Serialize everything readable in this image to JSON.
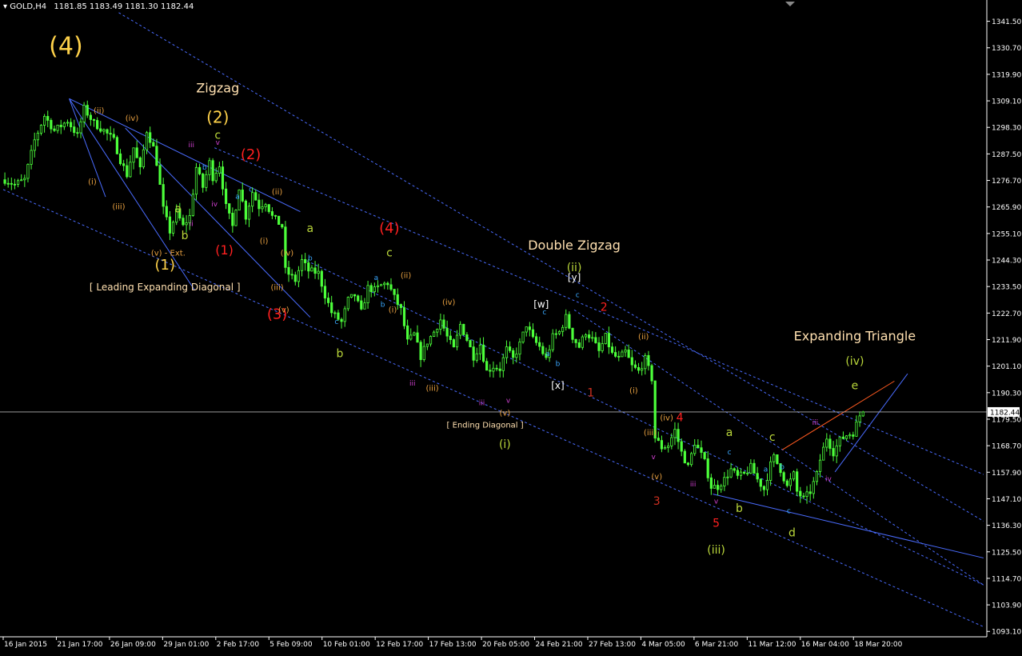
{
  "header": {
    "symbol": "GOLD,H4",
    "ohlc": "1181.85 1183.49 1181.30 1182.44",
    "menu_icon": "triangle-down-icon"
  },
  "colors": {
    "background": "#000000",
    "candle": "#4cff3a",
    "axis": "#ffffff",
    "channel": "#4a6cff",
    "wave_big": "#ffd24a",
    "wave_red": "#ff2020",
    "wave_olive": "#b9d63a",
    "wave_orange": "#e8a040",
    "wave_cyan": "#3aa8ff",
    "wave_magenta": "#d040d0",
    "wave_darkred": "#d03020",
    "label_beige": "#ffe0b0"
  },
  "chart_data": {
    "type": "candlestick",
    "title": "GOLD,H4",
    "ylim": [
      1093.1,
      1348
    ],
    "price_ticks": [
      "1341.50",
      "1330.70",
      "1319.90",
      "1309.10",
      "1298.30",
      "1287.50",
      "1276.70",
      "1265.90",
      "1255.10",
      "1244.30",
      "1233.50",
      "1222.70",
      "1211.90",
      "1201.10",
      "1190.30",
      "1179.50",
      "1168.70",
      "1157.90",
      "1147.10",
      "1136.30",
      "1125.50",
      "1114.70",
      "1103.90",
      "1093.10"
    ],
    "current_price": "1182.44",
    "time_ticks": [
      "16 Jan 2015",
      "21 Jan 17:00",
      "26 Jan 09:00",
      "29 Jan 01:00",
      "2 Feb 17:00",
      "5 Feb 09:00",
      "10 Feb 01:00",
      "12 Feb 17:00",
      "17 Feb 13:00",
      "20 Feb 05:00",
      "24 Feb 21:00",
      "27 Feb 13:00",
      "4 Mar 05:00",
      "6 Mar 21:00",
      "11 Mar 12:00",
      "16 Mar 04:00",
      "18 Mar 20:00"
    ],
    "close_path": [
      [
        0,
        1277
      ],
      [
        3,
        1275
      ],
      [
        6,
        1277
      ],
      [
        9,
        1293
      ],
      [
        12,
        1303
      ],
      [
        15,
        1297
      ],
      [
        19,
        1301
      ],
      [
        22,
        1295
      ],
      [
        24,
        1306
      ],
      [
        27,
        1300
      ],
      [
        30,
        1297
      ],
      [
        33,
        1293
      ],
      [
        35,
        1285
      ],
      [
        37,
        1279
      ],
      [
        39,
        1290
      ],
      [
        41,
        1281
      ],
      [
        43,
        1297
      ],
      [
        45,
        1290
      ],
      [
        46,
        1284
      ],
      [
        48,
        1265
      ],
      [
        50,
        1256
      ],
      [
        52,
        1264
      ],
      [
        54,
        1258
      ],
      [
        56,
        1262
      ],
      [
        58,
        1282
      ],
      [
        60,
        1274
      ],
      [
        62,
        1284
      ],
      [
        63,
        1278
      ],
      [
        65,
        1283
      ],
      [
        67,
        1266
      ],
      [
        69,
        1258
      ],
      [
        71,
        1274
      ],
      [
        73,
        1262
      ],
      [
        75,
        1272
      ],
      [
        77,
        1266
      ],
      [
        79,
        1268
      ],
      [
        81,
        1262
      ],
      [
        84,
        1258
      ],
      [
        85,
        1240
      ],
      [
        88,
        1236
      ],
      [
        90,
        1244
      ],
      [
        92,
        1240
      ],
      [
        95,
        1239
      ],
      [
        97,
        1230
      ],
      [
        99,
        1223
      ],
      [
        102,
        1219
      ],
      [
        104,
        1228
      ],
      [
        106,
        1230
      ],
      [
        108,
        1223
      ],
      [
        110,
        1233
      ],
      [
        112,
        1232
      ],
      [
        114,
        1234
      ],
      [
        116,
        1235
      ],
      [
        118,
        1229
      ],
      [
        120,
        1224
      ],
      [
        122,
        1211
      ],
      [
        124,
        1214
      ],
      [
        126,
        1205
      ],
      [
        128,
        1211
      ],
      [
        130,
        1215
      ],
      [
        132,
        1220
      ],
      [
        134,
        1213
      ],
      [
        136,
        1208
      ],
      [
        138,
        1218
      ],
      [
        140,
        1212
      ],
      [
        142,
        1205
      ],
      [
        144,
        1210
      ],
      [
        146,
        1199
      ],
      [
        148,
        1201
      ],
      [
        150,
        1200
      ],
      [
        152,
        1208
      ],
      [
        154,
        1204
      ],
      [
        156,
        1210
      ],
      [
        158,
        1218
      ],
      [
        160,
        1212
      ],
      [
        162,
        1209
      ],
      [
        164,
        1204
      ],
      [
        166,
        1213
      ],
      [
        168,
        1215
      ],
      [
        170,
        1221
      ],
      [
        172,
        1213
      ],
      [
        174,
        1209
      ],
      [
        176,
        1215
      ],
      [
        178,
        1212
      ],
      [
        180,
        1207
      ],
      [
        182,
        1213
      ],
      [
        184,
        1206
      ],
      [
        186,
        1204
      ],
      [
        188,
        1207
      ],
      [
        190,
        1201
      ],
      [
        192,
        1199
      ],
      [
        194,
        1204
      ],
      [
        196,
        1196
      ],
      [
        197,
        1172
      ],
      [
        199,
        1168
      ],
      [
        201,
        1169
      ],
      [
        203,
        1175
      ],
      [
        205,
        1166
      ],
      [
        207,
        1160
      ],
      [
        209,
        1170
      ],
      [
        211,
        1165
      ],
      [
        212,
        1162
      ],
      [
        214,
        1152
      ],
      [
        216,
        1152
      ],
      [
        218,
        1155
      ],
      [
        220,
        1159
      ],
      [
        222,
        1156
      ],
      [
        224,
        1157
      ],
      [
        226,
        1160
      ],
      [
        228,
        1155
      ],
      [
        230,
        1151
      ],
      [
        232,
        1161
      ],
      [
        233,
        1164
      ],
      [
        235,
        1159
      ],
      [
        237,
        1152
      ],
      [
        239,
        1157
      ],
      [
        240,
        1150
      ],
      [
        242,
        1147
      ],
      [
        244,
        1150
      ],
      [
        246,
        1157
      ],
      [
        247,
        1163
      ],
      [
        249,
        1172
      ],
      [
        251,
        1166
      ],
      [
        253,
        1171
      ],
      [
        255,
        1173
      ],
      [
        257,
        1174
      ],
      [
        259,
        1181
      ],
      [
        260,
        1182.44
      ]
    ],
    "last_bar_index": 260,
    "channels": [
      {
        "from": [
          20,
          1310
        ],
        "to": [
          90,
          1264
        ],
        "style": "solid"
      },
      {
        "from": [
          20,
          1310
        ],
        "to": [
          58,
          1232
        ],
        "style": "solid"
      },
      {
        "from": [
          20,
          1310
        ],
        "to": [
          31,
          1270
        ],
        "style": "solid"
      },
      {
        "from": [
          37,
          1298
        ],
        "to": [
          93,
          1221
        ],
        "style": "solid"
      },
      {
        "from": [
          0,
          1273
        ],
        "to": [
          297,
          1095
        ],
        "style": "dashed"
      },
      {
        "from": [
          35,
          1345
        ],
        "to": [
          297,
          1138
        ],
        "style": "dashed"
      },
      {
        "from": [
          92,
          1244
        ],
        "to": [
          297,
          1112
        ],
        "style": "dashed"
      },
      {
        "from": [
          64,
          1290
        ],
        "to": [
          297,
          1157
        ],
        "style": "dashed"
      },
      {
        "from": [
          173,
          1224
        ],
        "to": [
          297,
          1112
        ],
        "style": "dashed"
      },
      {
        "from": [
          215,
          1149
        ],
        "to": [
          297,
          1123
        ],
        "style": "solid"
      },
      {
        "from": [
          252,
          1158
        ],
        "to": [
          274,
          1198
        ],
        "style": "solid"
      },
      {
        "from": [
          236,
          1167
        ],
        "to": [
          270,
          1195
        ],
        "style": "solid-orange"
      }
    ]
  },
  "annotations": [
    {
      "text": "(4)",
      "x": 19,
      "y": 1331,
      "color": "wave_big",
      "size": 30
    },
    {
      "text": "Zigzag",
      "x": 65,
      "y": 1314,
      "color": "label_beige",
      "size": 16
    },
    {
      "text": "(2)",
      "x": 65,
      "y": 1302,
      "color": "wave_big",
      "size": 20
    },
    {
      "text": "c",
      "x": 65,
      "y": 1295,
      "color": "wave_olive",
      "size": 14
    },
    {
      "text": "(2)",
      "x": 75,
      "y": 1287,
      "color": "wave_red",
      "size": 18
    },
    {
      "text": "(1)",
      "x": 49,
      "y": 1242,
      "color": "wave_big",
      "size": 18
    },
    {
      "text": "(1)",
      "x": 67,
      "y": 1248,
      "color": "wave_red",
      "size": 16
    },
    {
      "text": "(3)",
      "x": 83,
      "y": 1222,
      "color": "wave_red",
      "size": 18
    },
    {
      "text": "(4)",
      "x": 117,
      "y": 1257,
      "color": "wave_red",
      "size": 18
    },
    {
      "text": "c",
      "x": 117,
      "y": 1247,
      "color": "wave_olive",
      "size": 14
    },
    {
      "text": "a",
      "x": 93,
      "y": 1257,
      "color": "wave_olive",
      "size": 14
    },
    {
      "text": "b",
      "x": 102,
      "y": 1206,
      "color": "wave_olive",
      "size": 14
    },
    {
      "text": "a",
      "x": 53,
      "y": 1265,
      "color": "wave_olive",
      "size": 14
    },
    {
      "text": "b",
      "x": 55,
      "y": 1254,
      "color": "wave_olive",
      "size": 14
    },
    {
      "text": "(v) - Ext.",
      "x": 50,
      "y": 1247,
      "color": "wave_orange",
      "size": 10
    },
    {
      "text": "[ Leading Expanding Diagonal ]",
      "x": 49,
      "y": 1233,
      "color": "label_beige",
      "size": 12
    },
    {
      "text": "Double Zigzag",
      "x": 173,
      "y": 1250,
      "color": "label_beige",
      "size": 16
    },
    {
      "text": "(ii)",
      "x": 173,
      "y": 1241,
      "color": "wave_olive",
      "size": 14
    },
    {
      "text": "[y]",
      "x": 173,
      "y": 1237,
      "color": "#ffffff",
      "size": 12
    },
    {
      "text": "[w]",
      "x": 163,
      "y": 1226,
      "color": "#ffffff",
      "size": 12
    },
    {
      "text": "[x]",
      "x": 168,
      "y": 1193,
      "color": "#ffffff",
      "size": 12
    },
    {
      "text": "[ Ending Diagonal ]",
      "x": 146,
      "y": 1177,
      "color": "label_beige",
      "size": 10
    },
    {
      "text": "(i)",
      "x": 152,
      "y": 1169,
      "color": "wave_olive",
      "size": 14
    },
    {
      "text": "(v)",
      "x": 152,
      "y": 1182,
      "color": "wave_orange",
      "size": 10
    },
    {
      "text": "2",
      "x": 182,
      "y": 1225,
      "color": "wave_red",
      "size": 14
    },
    {
      "text": "1",
      "x": 178,
      "y": 1190,
      "color": "wave_darkred",
      "size": 14
    },
    {
      "text": "3",
      "x": 198,
      "y": 1146,
      "color": "wave_darkred",
      "size": 14
    },
    {
      "text": "4",
      "x": 205,
      "y": 1180,
      "color": "wave_red",
      "size": 14
    },
    {
      "text": "5",
      "x": 216,
      "y": 1137,
      "color": "wave_red",
      "size": 14
    },
    {
      "text": "(iii)",
      "x": 216,
      "y": 1126,
      "color": "wave_olive",
      "size": 14
    },
    {
      "text": "a",
      "x": 220,
      "y": 1174,
      "color": "wave_olive",
      "size": 14
    },
    {
      "text": "b",
      "x": 223,
      "y": 1143,
      "color": "wave_olive",
      "size": 14
    },
    {
      "text": "c",
      "x": 233,
      "y": 1172,
      "color": "wave_olive",
      "size": 14
    },
    {
      "text": "d",
      "x": 239,
      "y": 1133,
      "color": "wave_olive",
      "size": 14
    },
    {
      "text": "e",
      "x": 258,
      "y": 1193,
      "color": "wave_olive",
      "size": 14
    },
    {
      "text": "(iv)",
      "x": 258,
      "y": 1203,
      "color": "wave_olive",
      "size": 14
    },
    {
      "text": "Expanding Triangle",
      "x": 258,
      "y": 1213,
      "color": "label_beige",
      "size": 16
    },
    {
      "text": "(ii)",
      "x": 29,
      "y": 1305,
      "color": "wave_orange",
      "size": 10
    },
    {
      "text": "(iv)",
      "x": 39,
      "y": 1302,
      "color": "wave_orange",
      "size": 10
    },
    {
      "text": "(i)",
      "x": 27,
      "y": 1276,
      "color": "wave_orange",
      "size": 10
    },
    {
      "text": "(iii)",
      "x": 35,
      "y": 1266,
      "color": "wave_orange",
      "size": 10
    },
    {
      "text": "(ii)",
      "x": 83,
      "y": 1272,
      "color": "wave_orange",
      "size": 10
    },
    {
      "text": "(i)",
      "x": 79,
      "y": 1252,
      "color": "wave_orange",
      "size": 10
    },
    {
      "text": "(iii)",
      "x": 83,
      "y": 1233,
      "color": "wave_orange",
      "size": 10
    },
    {
      "text": "(iv)",
      "x": 86,
      "y": 1247,
      "color": "wave_orange",
      "size": 10
    },
    {
      "text": "(v)",
      "x": 85,
      "y": 1224,
      "color": "wave_orange",
      "size": 10
    },
    {
      "text": "(ii)",
      "x": 122,
      "y": 1238,
      "color": "wave_orange",
      "size": 10
    },
    {
      "text": "(i)",
      "x": 118,
      "y": 1224,
      "color": "wave_orange",
      "size": 10
    },
    {
      "text": "(iv)",
      "x": 135,
      "y": 1227,
      "color": "wave_orange",
      "size": 10
    },
    {
      "text": "(iii)",
      "x": 130,
      "y": 1192,
      "color": "wave_orange",
      "size": 10
    },
    {
      "text": "(ii)",
      "x": 194,
      "y": 1213,
      "color": "wave_orange",
      "size": 10
    },
    {
      "text": "(i)",
      "x": 191,
      "y": 1191,
      "color": "wave_orange",
      "size": 10
    },
    {
      "text": "(iv)",
      "x": 201,
      "y": 1180,
      "color": "wave_orange",
      "size": 10
    },
    {
      "text": "(iii)",
      "x": 196,
      "y": 1174,
      "color": "wave_orange",
      "size": 10
    },
    {
      "text": "(v)",
      "x": 198,
      "y": 1156,
      "color": "wave_orange",
      "size": 10
    },
    {
      "text": "iii",
      "x": 57,
      "y": 1291,
      "color": "wave_magenta",
      "size": 9
    },
    {
      "text": "v",
      "x": 65,
      "y": 1292,
      "color": "wave_magenta",
      "size": 9
    },
    {
      "text": "iv",
      "x": 64,
      "y": 1267,
      "color": "wave_magenta",
      "size": 9
    },
    {
      "text": "ii",
      "x": 57,
      "y": 1259,
      "color": "wave_magenta",
      "size": 9
    },
    {
      "text": "iii",
      "x": 124,
      "y": 1194,
      "color": "wave_magenta",
      "size": 9
    },
    {
      "text": "iii",
      "x": 145,
      "y": 1186,
      "color": "wave_magenta",
      "size": 9
    },
    {
      "text": "v",
      "x": 153,
      "y": 1187,
      "color": "wave_magenta",
      "size": 9
    },
    {
      "text": "v",
      "x": 197,
      "y": 1164,
      "color": "wave_magenta",
      "size": 9
    },
    {
      "text": "iii",
      "x": 209,
      "y": 1153,
      "color": "wave_magenta",
      "size": 9
    },
    {
      "text": "v",
      "x": 216,
      "y": 1146,
      "color": "wave_magenta",
      "size": 9
    },
    {
      "text": "iii",
      "x": 246,
      "y": 1178,
      "color": "wave_magenta",
      "size": 9
    },
    {
      "text": "iv",
      "x": 250,
      "y": 1155,
      "color": "wave_magenta",
      "size": 9
    },
    {
      "text": "b",
      "x": 61,
      "y": 1282,
      "color": "wave_cyan",
      "size": 9
    },
    {
      "text": "a",
      "x": 71,
      "y": 1270,
      "color": "wave_cyan",
      "size": 9
    },
    {
      "text": "c",
      "x": 75,
      "y": 1273,
      "color": "wave_cyan",
      "size": 9
    },
    {
      "text": "b",
      "x": 93,
      "y": 1245,
      "color": "wave_cyan",
      "size": 9
    },
    {
      "text": "c",
      "x": 101,
      "y": 1219,
      "color": "wave_cyan",
      "size": 9
    },
    {
      "text": "a",
      "x": 113,
      "y": 1237,
      "color": "wave_cyan",
      "size": 9
    },
    {
      "text": "b",
      "x": 115,
      "y": 1226,
      "color": "wave_cyan",
      "size": 9
    },
    {
      "text": "c",
      "x": 164,
      "y": 1223,
      "color": "wave_cyan",
      "size": 9
    },
    {
      "text": "a",
      "x": 165,
      "y": 1206,
      "color": "wave_cyan",
      "size": 9
    },
    {
      "text": "b",
      "x": 168,
      "y": 1202,
      "color": "wave_cyan",
      "size": 9
    },
    {
      "text": "c",
      "x": 174,
      "y": 1230,
      "color": "wave_cyan",
      "size": 9
    },
    {
      "text": "c",
      "x": 220,
      "y": 1166,
      "color": "wave_cyan",
      "size": 9
    },
    {
      "text": "a",
      "x": 231,
      "y": 1159,
      "color": "wave_cyan",
      "size": 9
    },
    {
      "text": "b",
      "x": 236,
      "y": 1160,
      "color": "wave_cyan",
      "size": 9
    },
    {
      "text": "c",
      "x": 238,
      "y": 1142,
      "color": "wave_cyan",
      "size": 9
    }
  ]
}
